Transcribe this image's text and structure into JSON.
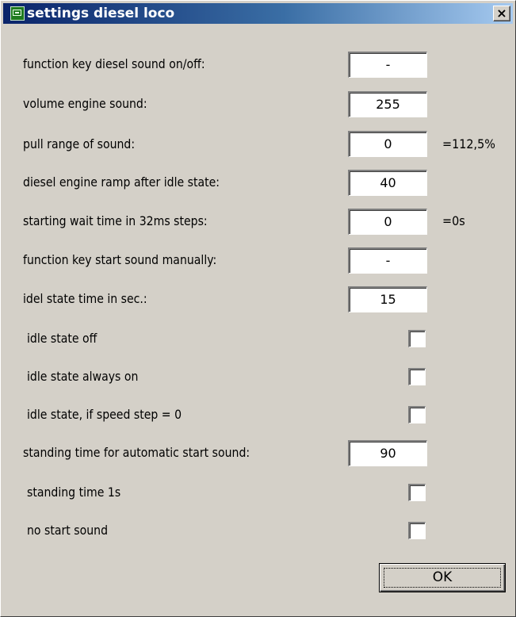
{
  "window": {
    "title": "settings diesel loco",
    "close_label": "×"
  },
  "fields": [
    {
      "label": "function key diesel sound on/off:",
      "value": "-",
      "suffix": ""
    },
    {
      "label": "volume engine sound:",
      "value": "255",
      "suffix": ""
    },
    {
      "label": "pull range of sound:",
      "value": "0",
      "suffix": "=112,5%"
    },
    {
      "label": "diesel engine ramp after idle state:",
      "value": "40",
      "suffix": ""
    },
    {
      "label": "starting wait time in 32ms steps:",
      "value": "0",
      "suffix": "=0s"
    },
    {
      "label": "function key start sound manually:",
      "value": "-",
      "suffix": ""
    },
    {
      "label": "idel state time in sec.:",
      "value": "15",
      "suffix": ""
    }
  ],
  "checkboxes": [
    {
      "label": "idle state off",
      "checked": false
    },
    {
      "label": "idle state always on",
      "checked": false
    },
    {
      "label": "idle state, if speed step = 0",
      "checked": false
    }
  ],
  "standing_field": {
    "label": "standing time for automatic start sound:",
    "value": "90"
  },
  "checkboxes2": [
    {
      "label": "standing time 1s",
      "checked": false
    },
    {
      "label": "no start sound",
      "checked": false
    }
  ],
  "ok_label": "OK"
}
